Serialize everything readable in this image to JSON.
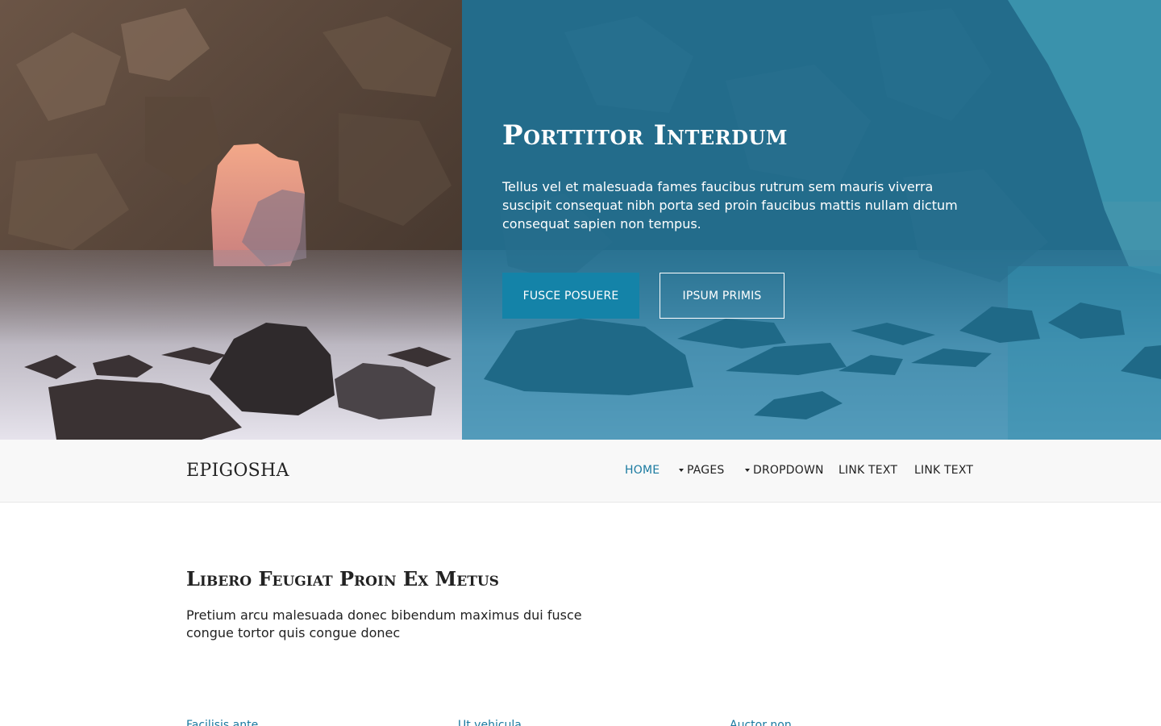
{
  "hero": {
    "title": "Porttitor Interdum",
    "text": "Tellus vel et malesuada fames faucibus rutrum sem mauris viverra suscipit consequat nibh porta sed proin faucibus mattis nullam dictum consequat sapien non tempus.",
    "primary_button": "FUSCE POSUERE",
    "secondary_button": "IPSUM PRIMIS",
    "overlay_color": "#1a7fa8",
    "accent_color": "#1483a8"
  },
  "navbar": {
    "brand": "EPIGOSHA",
    "items": [
      {
        "label": "HOME",
        "active": true,
        "dropdown": false
      },
      {
        "label": "PAGES",
        "active": false,
        "dropdown": true,
        "icon": "caret-down-icon"
      },
      {
        "label": "DROPDOWN",
        "active": false,
        "dropdown": true,
        "icon": "caret-down-icon"
      },
      {
        "label": "LINK TEXT",
        "active": false,
        "dropdown": false
      },
      {
        "label": "LINK TEXT",
        "active": false,
        "dropdown": false
      }
    ]
  },
  "main": {
    "title": "Libero Feugiat Proin Ex Metus",
    "text": "Pretium arcu malesuada donec bibendum maximus dui fusce congue tortor quis congue donec",
    "footer_links": [
      "Facilisis ante",
      "Ut vehicula",
      "Auctor non"
    ]
  }
}
